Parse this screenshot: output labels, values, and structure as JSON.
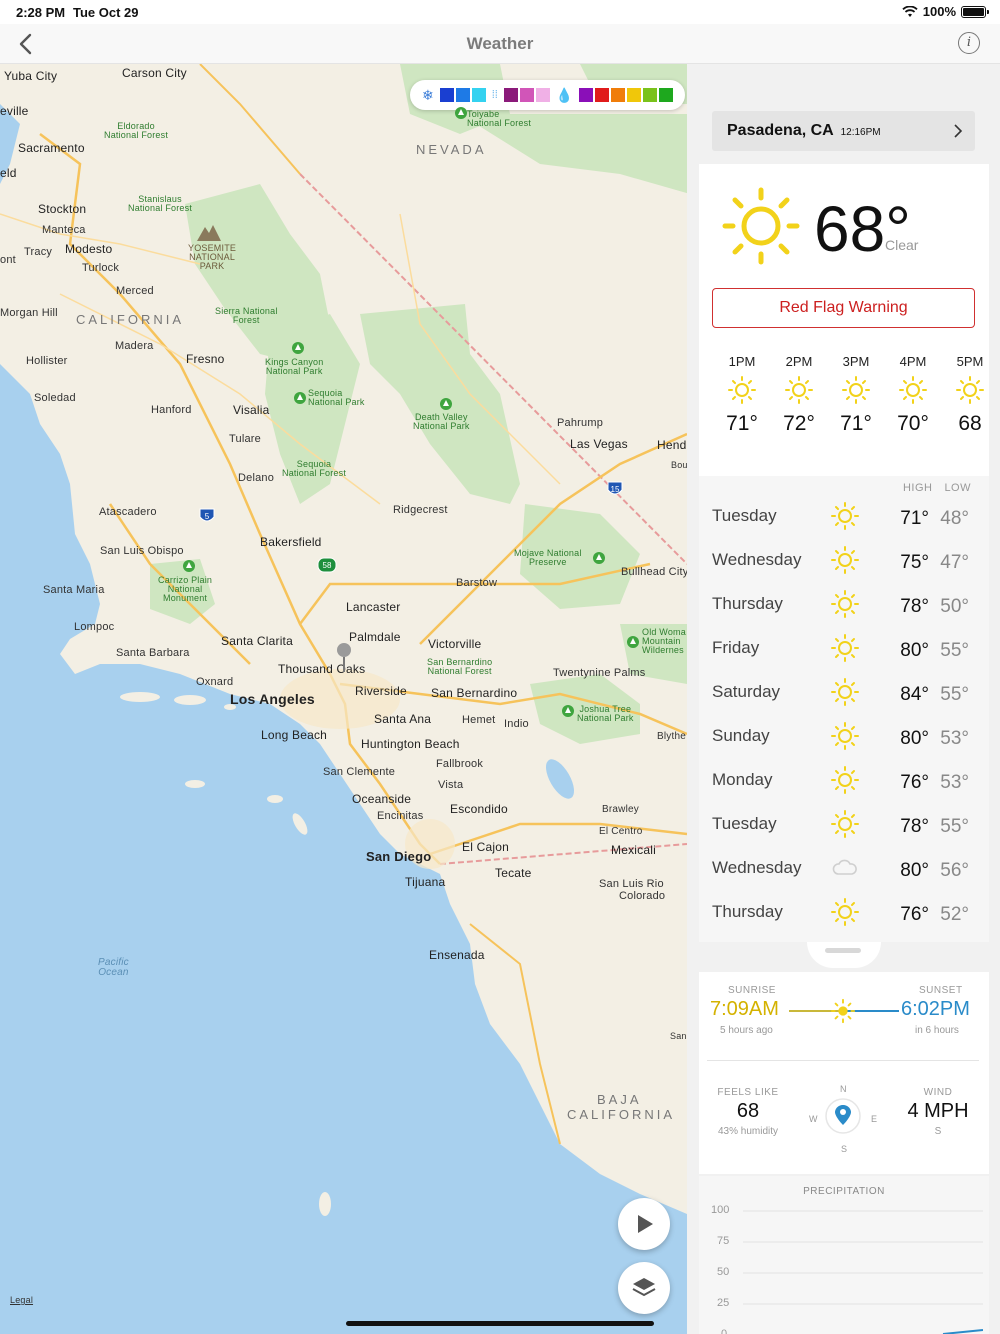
{
  "status_bar": {
    "time": "2:28 PM",
    "date": "Tue Oct 29",
    "battery": "100%"
  },
  "nav": {
    "title": "Weather"
  },
  "map": {
    "regions": {
      "nevada": "NEVADA",
      "california": "CALIFORNIA",
      "baja": "BAJA",
      "baja2": "CALIFORNIA"
    },
    "big_cities": {
      "la": "Los Angeles",
      "sd": "San Diego"
    },
    "cities": {
      "carson": "Carson City",
      "sacramento": "Sacramento",
      "stockton": "Stockton",
      "manteca": "Manteca",
      "modesto": "Modesto",
      "tracy": "Tracy",
      "turlock": "Turlock",
      "merced": "Merced",
      "morgan": "Morgan Hill",
      "madera": "Madera",
      "fresno": "Fresno",
      "hollister": "Hollister",
      "soledad": "Soledad",
      "hanford": "Hanford",
      "visalia": "Visalia",
      "tulare": "Tulare",
      "delano": "Delano",
      "atascadero": "Atascadero",
      "slo": "San Luis Obispo",
      "santamaria": "Santa Maria",
      "lompoc": "Lompoc",
      "santabarbara": "Santa Barbara",
      "bakersfield": "Bakersfield",
      "ridgecrest": "Ridgecrest",
      "pahrump": "Pahrump",
      "lasvegas": "Las Vegas",
      "hend": "Hend",
      "bou": "Bou",
      "barstow": "Barstow",
      "bullhead": "Bullhead City",
      "lancaster": "Lancaster",
      "palmdale": "Palmdale",
      "victorville": "Victorville",
      "santaclarita": "Santa Clarita",
      "oxnard": "Oxnard",
      "thousandoaks": "Thousand Oaks",
      "riverside": "Riverside",
      "sanbernardino": "San Bernardino",
      "twentynine": "Twentynine Palms",
      "santaana": "Santa Ana",
      "hemet": "Hemet",
      "indio": "Indio",
      "blythe": "Blythe",
      "longbeach": "Long Beach",
      "huntington": "Huntington Beach",
      "fallbrook": "Fallbrook",
      "sanclemente": "San Clemente",
      "vista": "Vista",
      "oceanside": "Oceanside",
      "encinitas": "Encinitas",
      "escondido": "Escondido",
      "brawley": "Brawley",
      "elcentro": "El Centro",
      "elcajon": "El Cajon",
      "mexicali": "Mexicali",
      "tijuana": "Tijuana",
      "tecate": "Tecate",
      "sanluisrio": "San Luis Rio",
      "colorado": "Colorado",
      "ensenada": "Ensenada",
      "ont": "ont",
      "eville": "eville",
      "eld": "eld",
      "yuba": "Yuba City",
      "san": "San"
    },
    "parks": {
      "toiyabe": "Toiyabe\nNational Forest",
      "eldorado": "Eldorado\nNational Forest",
      "stanislaus": "Stanislaus\nNational Forest",
      "yosemite": "YOSEMITE\nNATIONAL\nPARK",
      "sierra": "Sierra National\nForest",
      "kings": "Kings Canyon\nNational Park",
      "sequoiapark": "Sequoia\nNational Park",
      "deathvalley": "Death Valley\nNational Park",
      "sequoiaforest": "Sequoia\nNational Forest",
      "carrizo": "Carrizo Plain\nNational\nMonument",
      "mojave": "Mojave National\nPreserve",
      "oldwoman": "Old Woma\nMountain\nWildernes",
      "sbforest": "San Bernardino\nNational Forest",
      "joshua": "Joshua Tree\nNational Park"
    },
    "water": {
      "pacific": "Pacific\nOcean"
    },
    "highways": [
      "5",
      "58",
      "15"
    ],
    "legal": "Legal",
    "legend_colors": [
      "#1a3fd1",
      "#1e7ae6",
      "#34d2f0",
      "#8b1a7a",
      "#d155b8",
      "#f0b0e6",
      "#8a0fb8",
      "#e01b1b",
      "#f07d0a",
      "#f0c70a",
      "#7ac21b",
      "#1ea81e"
    ]
  },
  "panel": {
    "location": "Pasadena, CA",
    "location_time": "12:16PM",
    "current_temp": "68°",
    "condition": "Clear",
    "alert": "Red Flag Warning",
    "hourly": [
      {
        "time": "1PM",
        "temp": "71°",
        "icon": "sun-icon"
      },
      {
        "time": "2PM",
        "temp": "72°",
        "icon": "sun-icon"
      },
      {
        "time": "3PM",
        "temp": "71°",
        "icon": "sun-icon"
      },
      {
        "time": "4PM",
        "temp": "70°",
        "icon": "sun-icon"
      },
      {
        "time": "5PM",
        "temp": "68",
        "icon": "sun-icon"
      }
    ],
    "daily_header": {
      "high": "HIGH",
      "low": "LOW"
    },
    "daily": [
      {
        "day": "Tuesday",
        "high": "71°",
        "low": "48°",
        "icon": "sun-icon"
      },
      {
        "day": "Wednesday",
        "high": "75°",
        "low": "47°",
        "icon": "sun-icon"
      },
      {
        "day": "Thursday",
        "high": "78°",
        "low": "50°",
        "icon": "sun-icon"
      },
      {
        "day": "Friday",
        "high": "80°",
        "low": "55°",
        "icon": "sun-icon"
      },
      {
        "day": "Saturday",
        "high": "84°",
        "low": "55°",
        "icon": "sun-icon"
      },
      {
        "day": "Sunday",
        "high": "80°",
        "low": "53°",
        "icon": "sun-icon"
      },
      {
        "day": "Monday",
        "high": "76°",
        "low": "53°",
        "icon": "sun-icon"
      },
      {
        "day": "Tuesday",
        "high": "78°",
        "low": "55°",
        "icon": "sun-icon"
      },
      {
        "day": "Wednesday",
        "high": "80°",
        "low": "56°",
        "icon": "cloud-icon"
      },
      {
        "day": "Thursday",
        "high": "76°",
        "low": "52°",
        "icon": "sun-icon"
      }
    ],
    "sun": {
      "sunrise_label": "SUNRISE",
      "sunrise": "7:09AM",
      "sunrise_sub": "5 hours ago",
      "sunset_label": "SUNSET",
      "sunset": "6:02PM",
      "sunset_sub": "in 6 hours",
      "sunrise_color": "#d4b200",
      "sunset_color": "#2a8bc9"
    },
    "feels": {
      "label": "FEELS LIKE",
      "value": "68",
      "humidity": "43% humidity",
      "compass": {
        "n": "N",
        "e": "E",
        "s": "S",
        "w": "W"
      },
      "wind_label": "WIND",
      "wind": "4 MPH",
      "wind_dir": "S"
    },
    "precip": {
      "title": "PRECIPITATION",
      "ticks": [
        "100",
        "75",
        "50",
        "25",
        "0"
      ]
    }
  },
  "colors": {
    "sun": "#f2d21a",
    "alert": "#cc1f1f",
    "water": "#a8d0ee",
    "land": "#f3efe4",
    "park": "#cfe6c1"
  }
}
